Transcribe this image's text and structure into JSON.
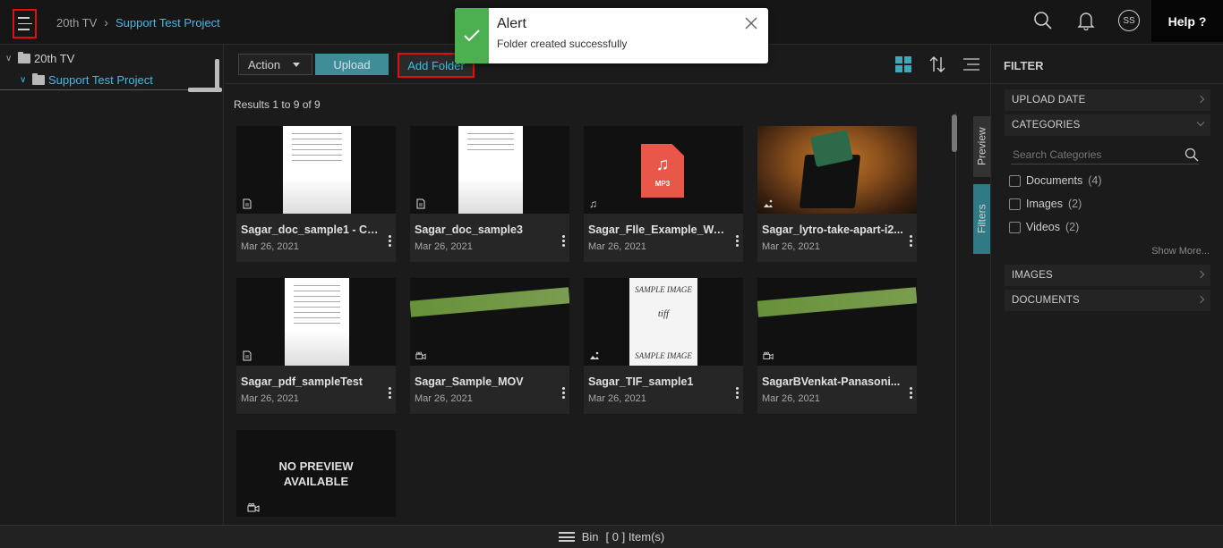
{
  "breadcrumb": {
    "parent": "20th TV",
    "current": "Support Test Project"
  },
  "header": {
    "help_label": "Help ?",
    "avatar_initials": "SS"
  },
  "alert": {
    "title": "Alert",
    "message": "Folder created successfully"
  },
  "tree": {
    "root": "20th TV",
    "child": "Support Test Project"
  },
  "toolbar": {
    "action_label": "Action",
    "upload_label": "Upload",
    "add_folder_label": "Add Folder"
  },
  "results_text": "Results 1 to 9 of 9",
  "assets": [
    {
      "name": "Sagar_doc_sample1 - Co...",
      "date": "Mar 26, 2021",
      "type": "document"
    },
    {
      "name": "Sagar_doc_sample3",
      "date": "Mar 26, 2021",
      "type": "document"
    },
    {
      "name": "Sagar_FIle_Example_WA...",
      "date": "Mar 26, 2021",
      "type": "audio",
      "badge": "MP3"
    },
    {
      "name": "Sagar_lytro-take-apart-i2...",
      "date": "Mar 26, 2021",
      "type": "image"
    },
    {
      "name": "Sagar_pdf_sampleTest",
      "date": "Mar 26, 2021",
      "type": "document"
    },
    {
      "name": "Sagar_Sample_MOV",
      "date": "Mar 26, 2021",
      "type": "video"
    },
    {
      "name": "Sagar_TIF_sample1",
      "date": "Mar 26, 2021",
      "type": "image",
      "thumb_top": "SAMPLE IMAGE",
      "thumb_mid": "tiff",
      "thumb_bottom": "SAMPLE IMAGE"
    },
    {
      "name": "SagarBVenkat-Panasoni...",
      "date": "Mar 26, 2021",
      "type": "video"
    },
    {
      "name": "",
      "date": "",
      "type": "video",
      "placeholder_line1": "NO PREVIEW",
      "placeholder_line2": "AVAILABLE"
    }
  ],
  "side_tabs": {
    "preview": "Preview",
    "filters": "Filters"
  },
  "filter": {
    "title": "FILTER",
    "sections": {
      "upload_date": "UPLOAD DATE",
      "categories": "CATEGORIES",
      "images": "IMAGES",
      "documents": "DOCUMENTS"
    },
    "search_placeholder": "Search Categories",
    "categories": [
      {
        "label": "Documents",
        "count": "(4)"
      },
      {
        "label": "Images",
        "count": "(2)"
      },
      {
        "label": "Videos",
        "count": "(2)"
      }
    ],
    "show_more": "Show More..."
  },
  "bin": {
    "label": "Bin",
    "count_text": "[ 0 ] Item(s)"
  },
  "colors": {
    "accent": "#3bbde5",
    "upload_btn": "#3f8d97",
    "success": "#4caf50",
    "highlight": "#e01010"
  }
}
